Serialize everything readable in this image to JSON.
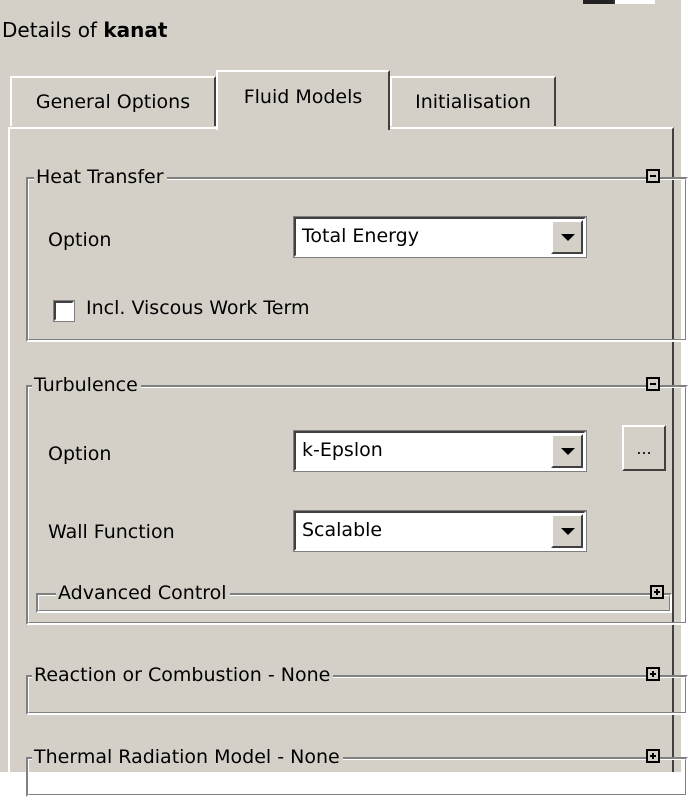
{
  "header": {
    "title_prefix": "Details of ",
    "title_object": "kanat"
  },
  "tabs": [
    {
      "label": "General Options",
      "active": false
    },
    {
      "label": "Fluid Models",
      "active": true
    },
    {
      "label": "Initialisation",
      "active": false
    }
  ],
  "heat_transfer": {
    "legend": "Heat Transfer",
    "option_label": "Option",
    "option_value": "Total Energy",
    "checkbox_label": "Incl. Viscous Work Term",
    "checkbox_checked": false
  },
  "turbulence": {
    "legend": "Turbulence",
    "option_label": "Option",
    "option_value": "k-Epslon",
    "ellipsis_label": "...",
    "wall_function_label": "Wall Function",
    "wall_function_value": "Scalable",
    "advanced_legend": "Advanced Control"
  },
  "reaction": {
    "legend": "Reaction or Combustion - None"
  },
  "radiation": {
    "legend": "Thermal Radiation Model - None"
  },
  "icons": {
    "collapse": "minus-box-icon",
    "expand": "plus-box-icon",
    "dropdown": "down-arrow-icon"
  },
  "colors": {
    "panel": "#d4d0c8",
    "field": "#ffffff",
    "shadow": "#808080"
  }
}
